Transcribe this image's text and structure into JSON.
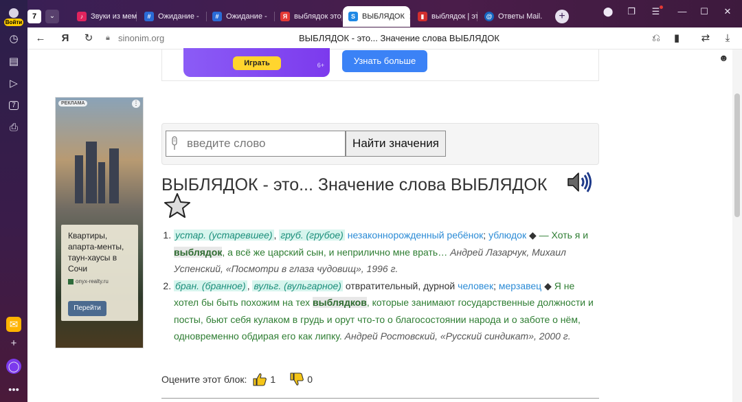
{
  "browser": {
    "login_label": "Войти",
    "tab_count": "7",
    "tabs": [
      {
        "title": "Звуки из мем",
        "color": "#e0245e",
        "glyph": "♪"
      },
      {
        "title": "Ожидание - ",
        "color": "#2a6bd6",
        "glyph": "#"
      },
      {
        "title": "Ожидание - ",
        "color": "#2a6bd6",
        "glyph": "#"
      },
      {
        "title": "выблядок это",
        "color": "#e53935",
        "glyph": "Я"
      },
      {
        "title": "ВЫБЛЯДОК",
        "color": "#1e88e5",
        "glyph": "S"
      },
      {
        "title": "выблядок | эт",
        "color": "#d32f2f",
        "glyph": "▮"
      },
      {
        "title": "Ответы Mail.",
        "color": "#1565c0",
        "glyph": "@"
      }
    ],
    "domain": "sinonim.org",
    "page_title": "ВЫБЛЯДОК - это... Значение слова ВЫБЛЯДОК"
  },
  "top_ad": {
    "play_label": "Играть",
    "age": "6+",
    "learn_more_label": "Узнать больше"
  },
  "side_ad": {
    "ad_label": "РЕКЛАМА",
    "text": "Квартиры, апарта-менты, таун-хаусы в Сочи",
    "site": "onyx-realty.ru",
    "button_label": "Перейти"
  },
  "search": {
    "placeholder": "введите слово",
    "button_label": "Найти значения"
  },
  "heading": "ВЫБЛЯДОК - это... Значение слова ВЫБЛЯДОК",
  "definitions": [
    {
      "labels": [
        "устар. (устаревшее)",
        "груб. (грубое)"
      ],
      "links": [
        "незаконнорожденный ребёнок",
        "ублюдок"
      ],
      "plain": "",
      "example_pre": " — Хоть я и ",
      "example_bold": "выблядок",
      "example_post": ", а всё же царский сын, и неприлично мне врать… ",
      "author": "Андрей Лазарчук, Михаил Успенский, «Посмотри в глаза чудовищ», 1996 г."
    },
    {
      "labels": [
        "бран. (бранное)",
        "вульг. (вульгарное)"
      ],
      "plain": "отвратительный, дурной",
      "links": [
        "человек",
        "мерзавец"
      ],
      "example_pre": " Я не хотел бы быть похожим на тех ",
      "example_bold": "выблядков",
      "example_post": ", которые занимают государственные должности и посты, бьют себя кулаком в грудь и орут что-то о благосостоянии народа и о заботе о нём, одновременно обдирая его как липку. ",
      "author": "Андрей Ростовский, «Русский синдикат», 2000 г."
    }
  ],
  "rating": {
    "label": "Оцените этот блок:",
    "likes": "1",
    "dislikes": "0"
  }
}
